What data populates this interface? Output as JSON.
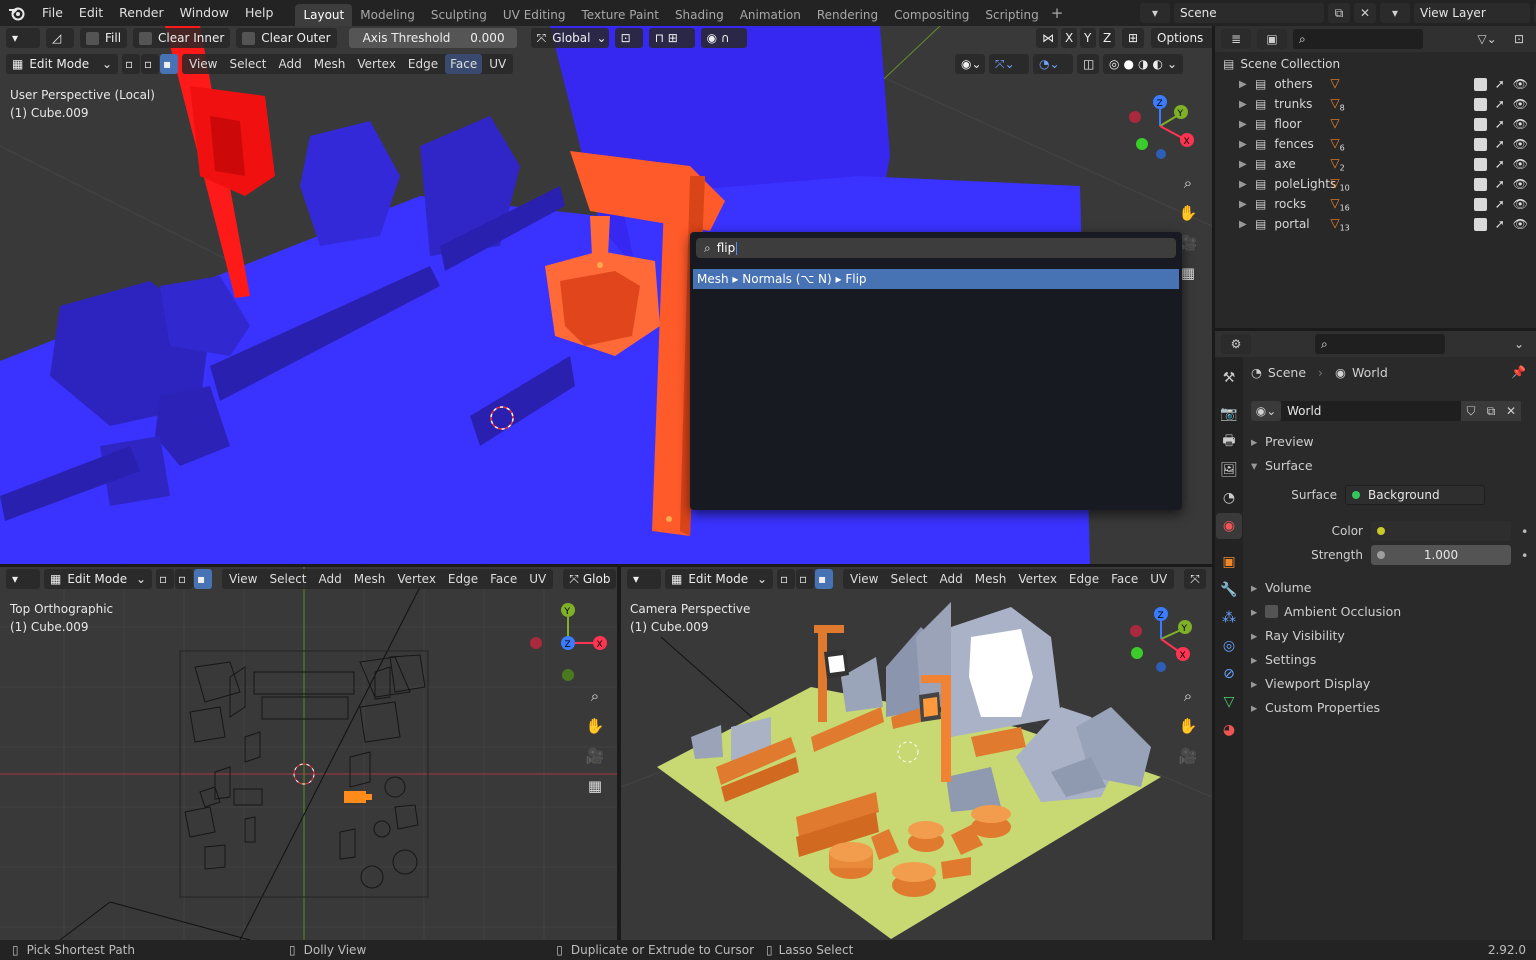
{
  "menus": [
    "File",
    "Edit",
    "Render",
    "Window",
    "Help"
  ],
  "workspaces": [
    "Layout",
    "Modeling",
    "Sculpting",
    "UV Editing",
    "Texture Paint",
    "Shading",
    "Animation",
    "Rendering",
    "Compositing",
    "Scripting"
  ],
  "active_workspace": "Layout",
  "scene_name": "Scene",
  "view_layer": "View Layer",
  "tool_header": {
    "fill": "Fill",
    "clear_inner": "Clear Inner",
    "clear_outer": "Clear Outer",
    "axis_threshold_label": "Axis Threshold",
    "axis_threshold_value": "0.000",
    "orientation": "Global",
    "options": "Options",
    "axes": [
      "X",
      "Y",
      "Z"
    ]
  },
  "main_viewport": {
    "mode": "Edit Mode",
    "menus": [
      "View",
      "Select",
      "Add",
      "Mesh",
      "Vertex",
      "Edge",
      "Face",
      "UV"
    ],
    "label1": "User Perspective (Local)",
    "label2": "(1) Cube.009"
  },
  "search_popup": {
    "query": "flip",
    "result_path": "Mesh ▸ Normals (⌥ N) ▸ Flip"
  },
  "bottom_left": {
    "mode": "Edit Mode",
    "menus": [
      "View",
      "Select",
      "Add",
      "Mesh",
      "Vertex",
      "Edge",
      "Face",
      "UV"
    ],
    "orientation": "Glob",
    "label1": "Top Orthographic",
    "label2": "(1) Cube.009"
  },
  "bottom_right": {
    "mode": "Edit Mode",
    "menus": [
      "View",
      "Select",
      "Add",
      "Mesh",
      "Vertex",
      "Edge",
      "Face",
      "UV"
    ],
    "label1": "Camera Perspective",
    "label2": "(1) Cube.009"
  },
  "outliner": {
    "root": "Scene Collection",
    "items": [
      {
        "name": "others",
        "count": ""
      },
      {
        "name": "trunks",
        "count": "8"
      },
      {
        "name": "floor",
        "count": ""
      },
      {
        "name": "fences",
        "count": "6"
      },
      {
        "name": "axe",
        "count": "2"
      },
      {
        "name": "poleLights",
        "count": "10"
      },
      {
        "name": "rocks",
        "count": "16"
      },
      {
        "name": "portal",
        "count": "13"
      }
    ]
  },
  "properties": {
    "breadcrumb_scene": "Scene",
    "breadcrumb_world": "World",
    "world_name": "World",
    "panels": {
      "preview": "Preview",
      "surface": "Surface",
      "volume": "Volume",
      "ambient_occlusion": "Ambient Occlusion",
      "ray_visibility": "Ray Visibility",
      "settings": "Settings",
      "viewport_display": "Viewport Display",
      "custom_properties": "Custom Properties"
    },
    "surface_label": "Surface",
    "surface_value": "Background",
    "color_label": "Color",
    "strength_label": "Strength",
    "strength_value": "1.000"
  },
  "status": {
    "left": "Pick Shortest Path",
    "middle": "Dolly View",
    "right1": "Duplicate or Extrude to Cursor",
    "right2": "Lasso Select",
    "version": "2.92.0"
  },
  "colors": {
    "accent": "#4772b3",
    "selection_orange": "#ff5a2a",
    "mesh_blue": "#3a32ff",
    "ground_green": "#c8d872"
  }
}
